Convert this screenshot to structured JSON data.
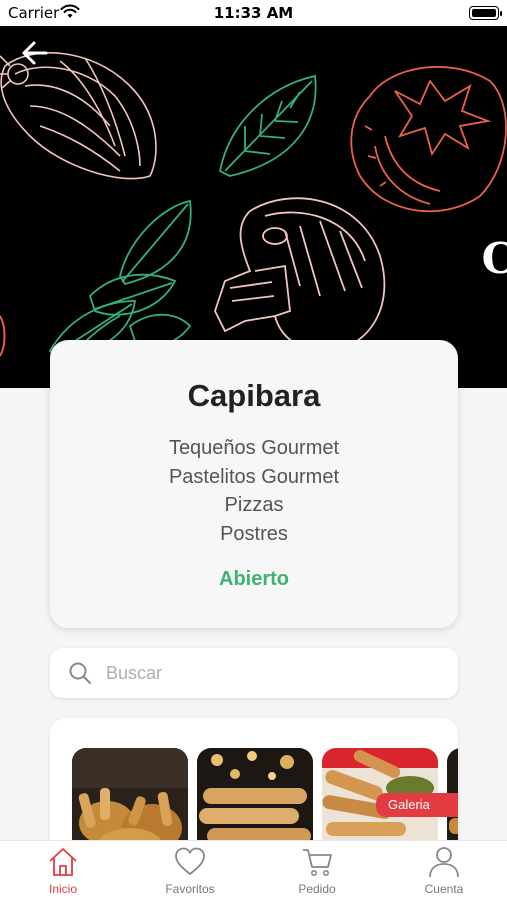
{
  "status_bar": {
    "carrier": "Carrier",
    "time": "11:33 AM"
  },
  "restaurant": {
    "name": "Capibara",
    "categories": [
      "Tequeños Gourmet",
      "Pastelitos Gourmet",
      "Pizzas",
      "Postres"
    ],
    "status": "Abierto",
    "status_color": "#3bb371"
  },
  "hero": {
    "partial_title_letter": "C"
  },
  "search": {
    "placeholder": "Buscar",
    "value": ""
  },
  "gallery": {
    "badge_label": "Galeria",
    "badge_color": "#e23b41"
  },
  "tab_bar": {
    "items": [
      {
        "label": "Inicio",
        "icon": "home-icon",
        "active": true
      },
      {
        "label": "Favoritos",
        "icon": "heart-icon",
        "active": false
      },
      {
        "label": "Pedido",
        "icon": "cart-icon",
        "active": false
      },
      {
        "label": "Cuenta",
        "icon": "user-icon",
        "active": false
      }
    ],
    "active_color": "#e23b41"
  }
}
